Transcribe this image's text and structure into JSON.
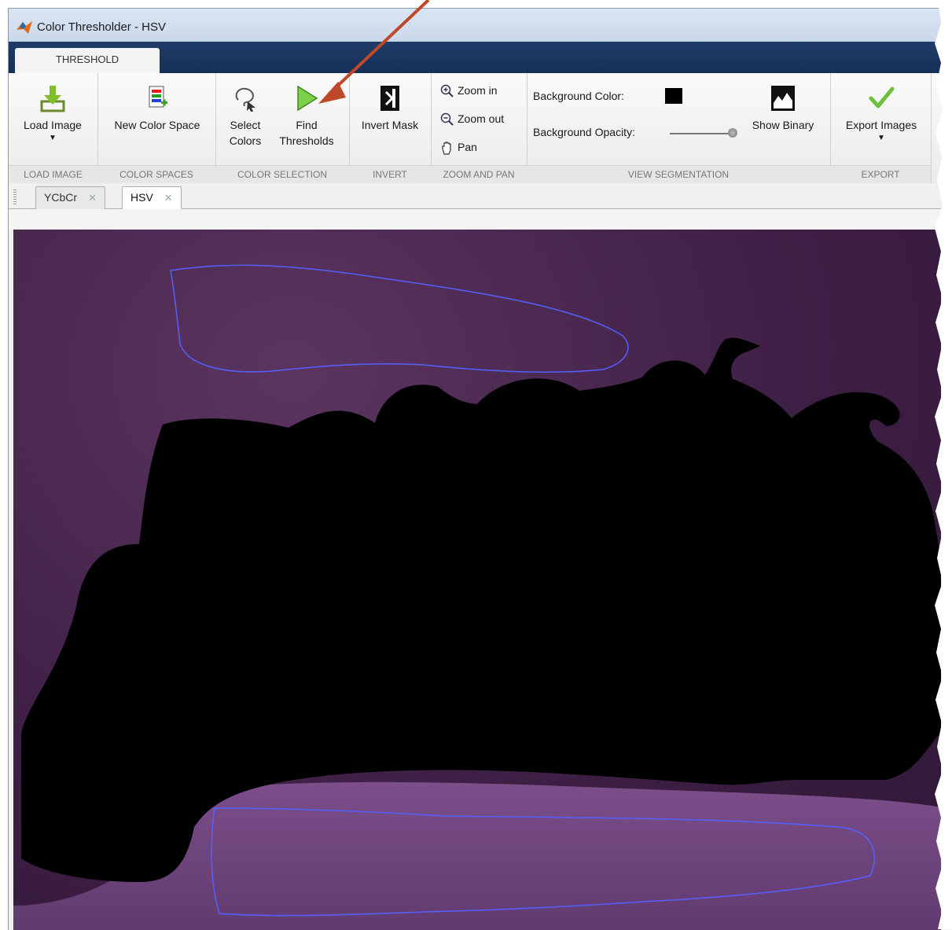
{
  "window": {
    "title": "Color Thresholder - HSV"
  },
  "ribbon": {
    "tab": "THRESHOLD",
    "sections": {
      "load_image": "LOAD IMAGE",
      "color_spaces": "COLOR SPACES",
      "color_selection": "COLOR SELECTION",
      "invert": "INVERT",
      "zoom_and_pan": "ZOOM AND PAN",
      "view_segmentation": "VIEW SEGMENTATION",
      "export": "EXPORT"
    },
    "buttons": {
      "load_image": "Load Image",
      "new_color_space": "New Color Space",
      "select_colors_1": "Select",
      "select_colors_2": "Colors",
      "find_thresholds_1": "Find",
      "find_thresholds_2": "Thresholds",
      "invert_mask": "Invert Mask",
      "zoom_in": "Zoom in",
      "zoom_out": "Zoom out",
      "pan": "Pan",
      "show_binary": "Show Binary",
      "export_images": "Export Images"
    },
    "view": {
      "background_color_label": "Background Color:",
      "background_opacity_label": "Background Opacity:",
      "background_color": "#000000",
      "opacity_value": 1.0
    }
  },
  "doc_tabs": [
    {
      "label": "YCbCr",
      "active": false
    },
    {
      "label": "HSV",
      "active": true
    }
  ],
  "colors": {
    "accent_arrow": "#c0482a",
    "ribbon_dark": "#1a3660",
    "roi_outline": "#5560ff"
  }
}
